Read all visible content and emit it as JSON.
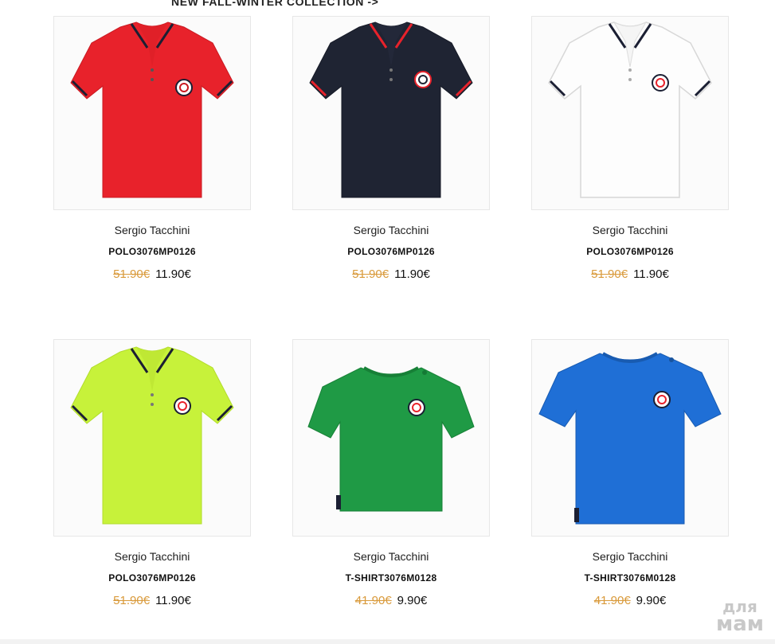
{
  "banner": {
    "text": "NEW FALL-WINTER COLLECTION ->"
  },
  "products": [
    {
      "brand": "Sergio Tacchini",
      "code": "POLO3076MP0126",
      "old_price": "51.90€",
      "new_price": "11.90€",
      "color": "#e8222b",
      "type": "polo"
    },
    {
      "brand": "Sergio Tacchini",
      "code": "POLO3076MP0126",
      "old_price": "51.90€",
      "new_price": "11.90€",
      "color": "#1f2433",
      "type": "polo"
    },
    {
      "brand": "Sergio Tacchini",
      "code": "POLO3076MP0126",
      "old_price": "51.90€",
      "new_price": "11.90€",
      "color": "#f7f7f7",
      "type": "polo"
    },
    {
      "brand": "Sergio Tacchini",
      "code": "POLO3076MP0126",
      "old_price": "51.90€",
      "new_price": "11.90€",
      "color": "#c7f23a",
      "type": "polo"
    },
    {
      "brand": "Sergio Tacchini",
      "code": "T-SHIRT3076M0128",
      "old_price": "41.90€",
      "new_price": "9.90€",
      "color": "#1f9a45",
      "type": "tshirt"
    },
    {
      "brand": "Sergio Tacchini",
      "code": "T-SHIRT3076M0128",
      "old_price": "41.90€",
      "new_price": "9.90€",
      "color": "#1f6fd6",
      "type": "tshirt"
    }
  ],
  "watermark": {
    "line1": "для",
    "line2": "мам"
  }
}
